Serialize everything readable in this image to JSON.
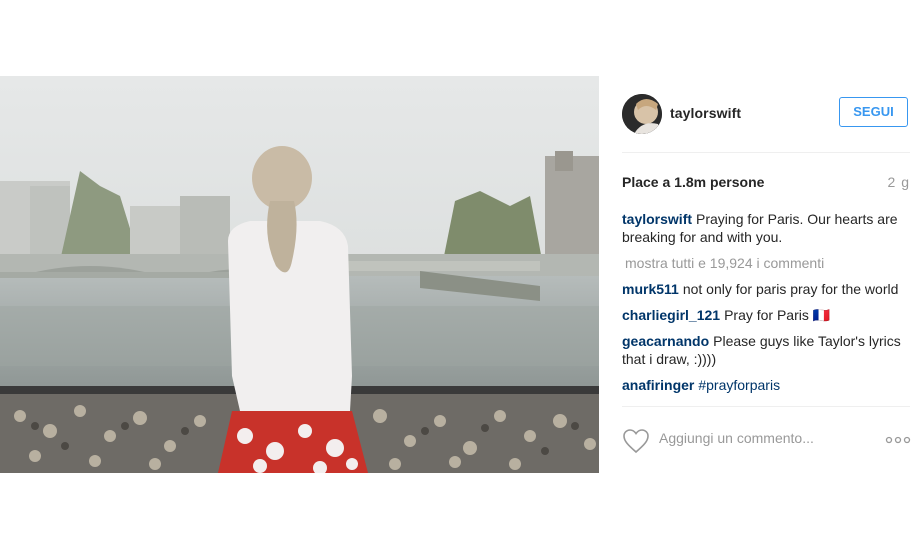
{
  "post": {
    "username": "taylorswift",
    "follow_label": "SEGUI",
    "likes_text": "Place a 1.8m persone",
    "time_ago": "2 g",
    "caption": {
      "username": "taylorswift",
      "text": "Praying for Paris. Our hearts are breaking for and with you."
    },
    "view_all_comments": "mostra tutti e 19,924 i commenti",
    "comments": [
      {
        "username": "murk511",
        "text": "not only for paris pray for the world"
      },
      {
        "username": "charliegirl_121",
        "text": "Pray for Paris 🇫🇷"
      },
      {
        "username": "geacarnando",
        "text": "Please guys like Taylor's lyrics that i draw, :))))"
      },
      {
        "username": "anafiringer",
        "hashtag": "#prayforparis"
      }
    ],
    "add_comment_placeholder": "Aggiungi un commento...",
    "icons": {
      "like": "heart-icon",
      "more": "more-options-icon",
      "avatar": "avatar-image"
    },
    "colors": {
      "accent": "#3897f0",
      "username": "#003569",
      "muted": "#999999",
      "text": "#262626"
    }
  }
}
